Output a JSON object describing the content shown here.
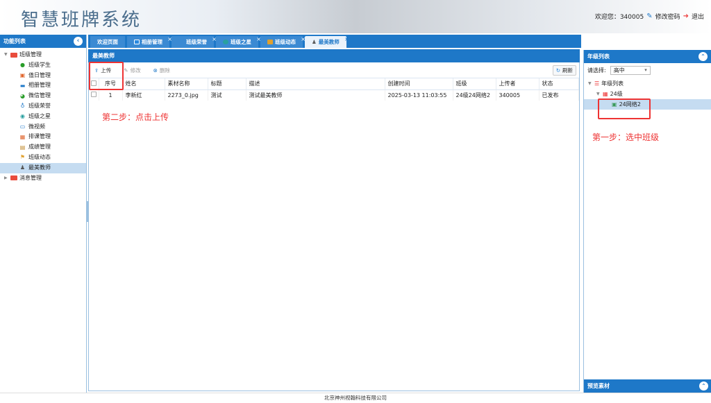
{
  "header": {
    "app_title": "智慧班牌系统",
    "welcome": "欢迎您：340005",
    "change_password": "修改密码",
    "logout": "退出"
  },
  "sidebar": {
    "title": "功能列表",
    "groups": [
      {
        "label": "班级管理",
        "items": [
          "班级学生",
          "值日管理",
          "相册管理",
          "微信管理",
          "班级荣誉",
          "班级之星",
          "微视频",
          "排课管理",
          "成绩管理",
          "班级动态",
          "最美教师"
        ]
      },
      {
        "label": "消息管理",
        "items": []
      }
    ],
    "selected": "最美教师"
  },
  "tabs": [
    "欢迎页面",
    "相册管理",
    "班级荣誉",
    "班级之星",
    "班级动态",
    "最美教师"
  ],
  "main": {
    "title": "最美教师",
    "toolbar": {
      "upload": "上传",
      "edit": "修改",
      "delete": "删除",
      "refresh": "刷新"
    },
    "columns": [
      "序号",
      "姓名",
      "素材名称",
      "标题",
      "描述",
      "创建时间",
      "班级",
      "上传者",
      "状态"
    ],
    "rows": [
      [
        "1",
        "李新红",
        "2273_0.jpg",
        "测试",
        "测试最美教师",
        "2025-03-13 11:03:55",
        "24级24网络2",
        "340005",
        "已发布"
      ]
    ],
    "annotation": "第二步：点击上传"
  },
  "right": {
    "title": "年级列表",
    "select_label": "请选择:",
    "select_value": "高中",
    "tree": {
      "root": "年级列表",
      "grade": "24级",
      "class": "24网络2"
    },
    "annotation": "第一步：选中班级",
    "bottom_title": "预览素材"
  },
  "footer": "北京神州视翰科技有限公司",
  "colors": {
    "accent": "#1e78c8",
    "annotation": "#e33333",
    "selected_row": "#c5dcf1"
  }
}
